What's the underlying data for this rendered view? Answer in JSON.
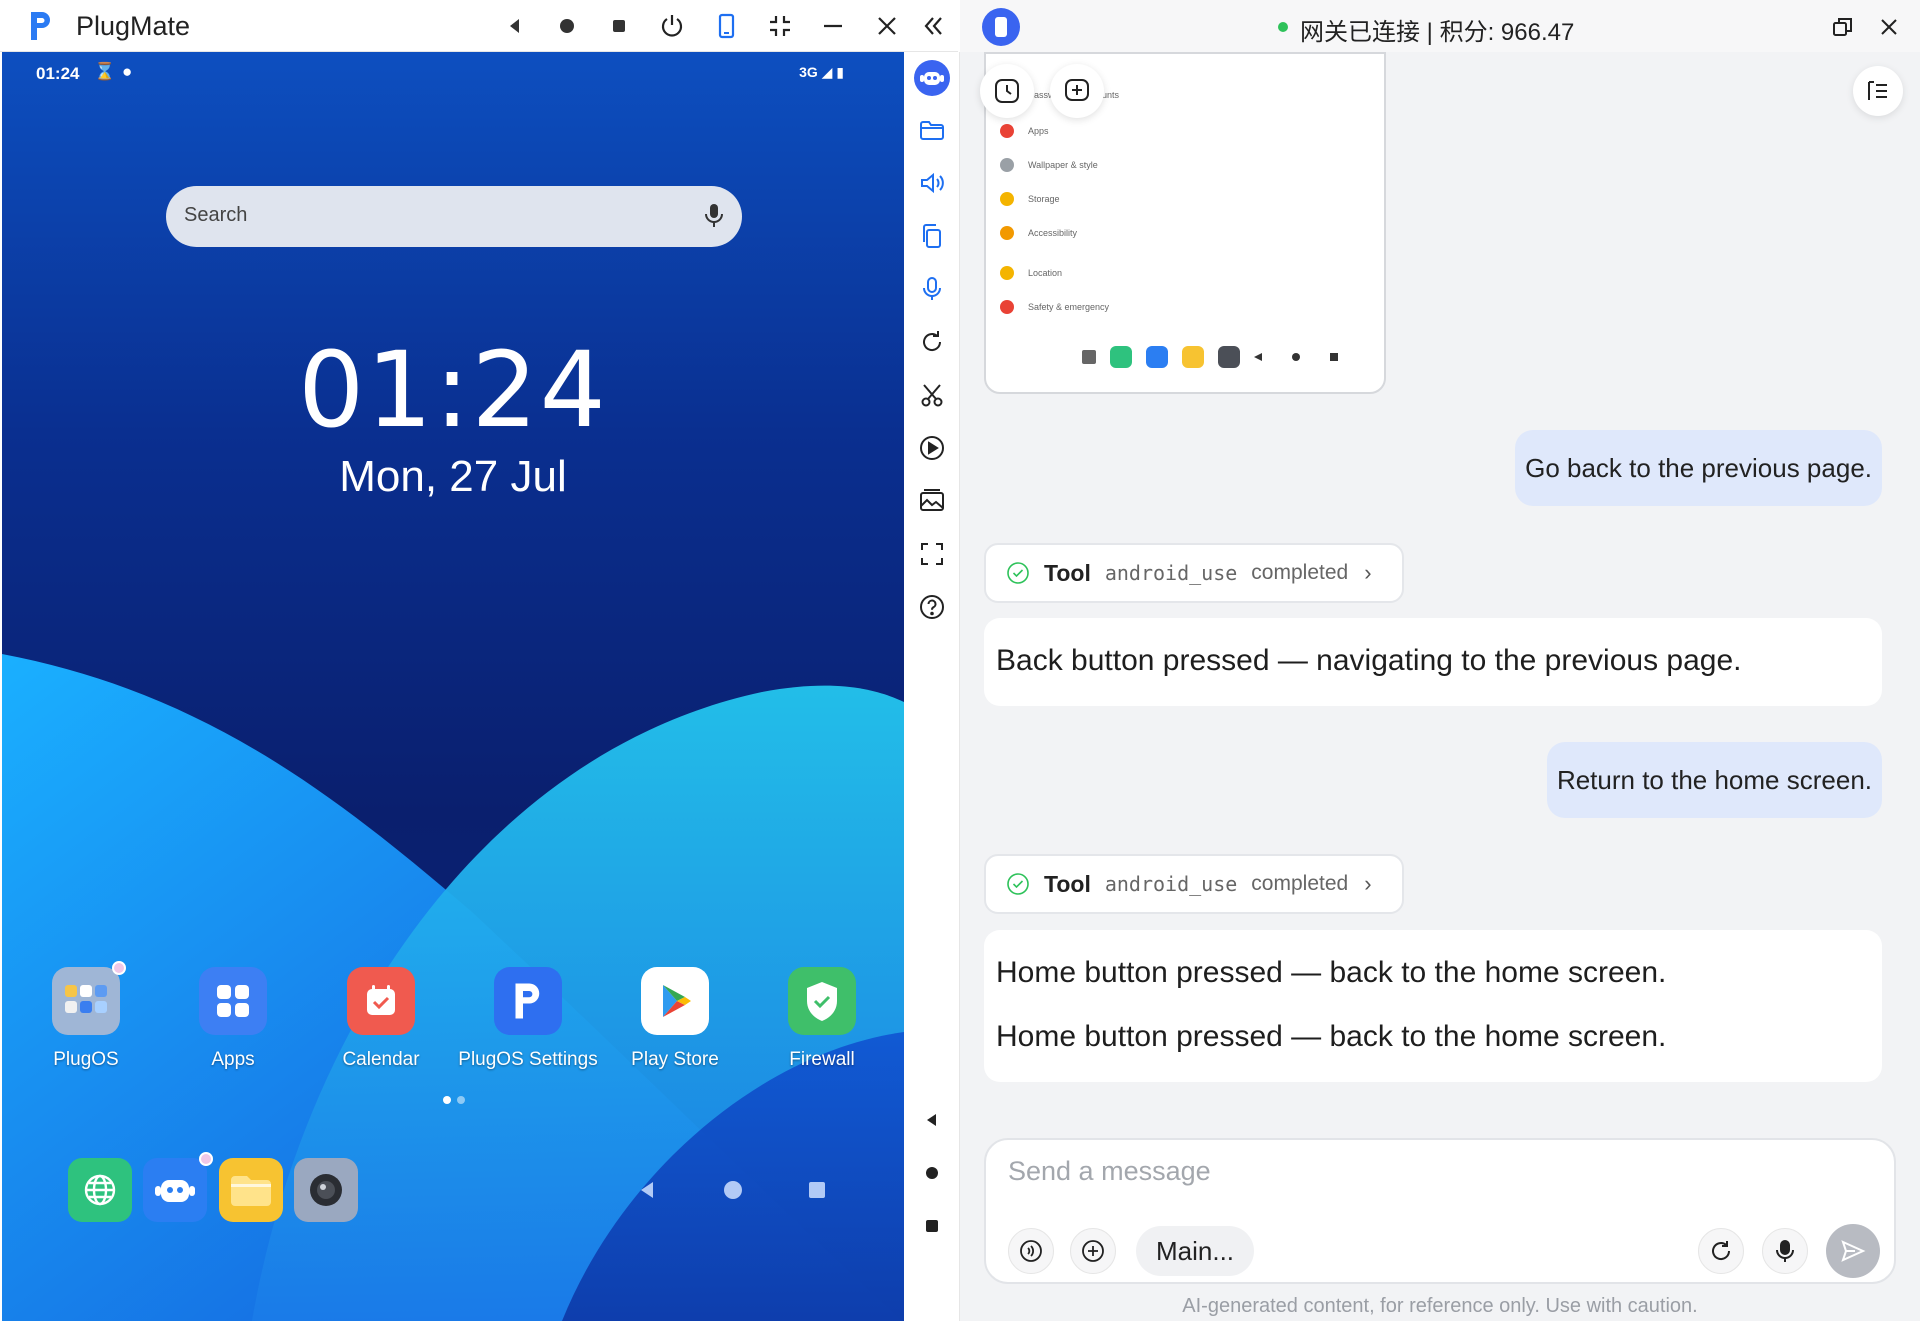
{
  "window": {
    "app_title": "PlugMate",
    "toolbar_icons": [
      "back-icon",
      "home-icon",
      "stop-icon",
      "power-icon",
      "phone-icon",
      "shrink-icon",
      "minimize-icon",
      "close-icon",
      "collapse-icon"
    ]
  },
  "phone": {
    "status_time": "01:24",
    "status_network": "3G",
    "search_placeholder": "Search",
    "clock_time": "01:24",
    "clock_date": "Mon, 27 Jul",
    "apps": [
      {
        "label": "PlugOS"
      },
      {
        "label": "Apps"
      },
      {
        "label": "Calendar"
      },
      {
        "label": "PlugOS Settings"
      },
      {
        "label": "Play Store"
      },
      {
        "label": "Firewall"
      }
    ],
    "page_indicator": {
      "current": 1,
      "total": 2
    }
  },
  "side_toolbar": {
    "icons": [
      "robot-icon",
      "folder-icon",
      "volume-icon",
      "copy-icon",
      "mic-icon",
      "rotate-icon",
      "scissors-icon",
      "play-icon",
      "gallery-icon",
      "fullscreen-icon",
      "help-icon"
    ],
    "bottom_icons": [
      "back-triangle-icon",
      "home-dot-icon",
      "recents-square-icon"
    ]
  },
  "chat": {
    "status_text": "网关已连接 | 积分: 966.47",
    "thumbnail_rows": [
      "Passwords & accounts",
      "Apps",
      "Wallpaper & style",
      "Storage",
      "Accessibility",
      "Location",
      "Safety & emergency"
    ],
    "messages": [
      {
        "role": "user",
        "text": "Go back to the previous page."
      },
      {
        "role": "tool",
        "word": "Tool",
        "name": "android_use",
        "status": "completed"
      },
      {
        "role": "assistant",
        "lines": [
          "Back button pressed — navigating to the previous page."
        ]
      },
      {
        "role": "user",
        "text": "Return to the home screen."
      },
      {
        "role": "tool",
        "word": "Tool",
        "name": "android_use",
        "status": "completed"
      },
      {
        "role": "assistant",
        "lines": [
          "Home button pressed — back to the home screen.",
          "Home button pressed — back to the home screen."
        ]
      }
    ],
    "composer": {
      "placeholder": "Send a message",
      "model_label": "Main..."
    },
    "disclaimer": "AI-generated content, for reference only. Use with caution.",
    "colors": {
      "accent": "#1e6ff1",
      "user_bubble": "#dfe8fb",
      "status_green": "#2ec25a"
    }
  }
}
